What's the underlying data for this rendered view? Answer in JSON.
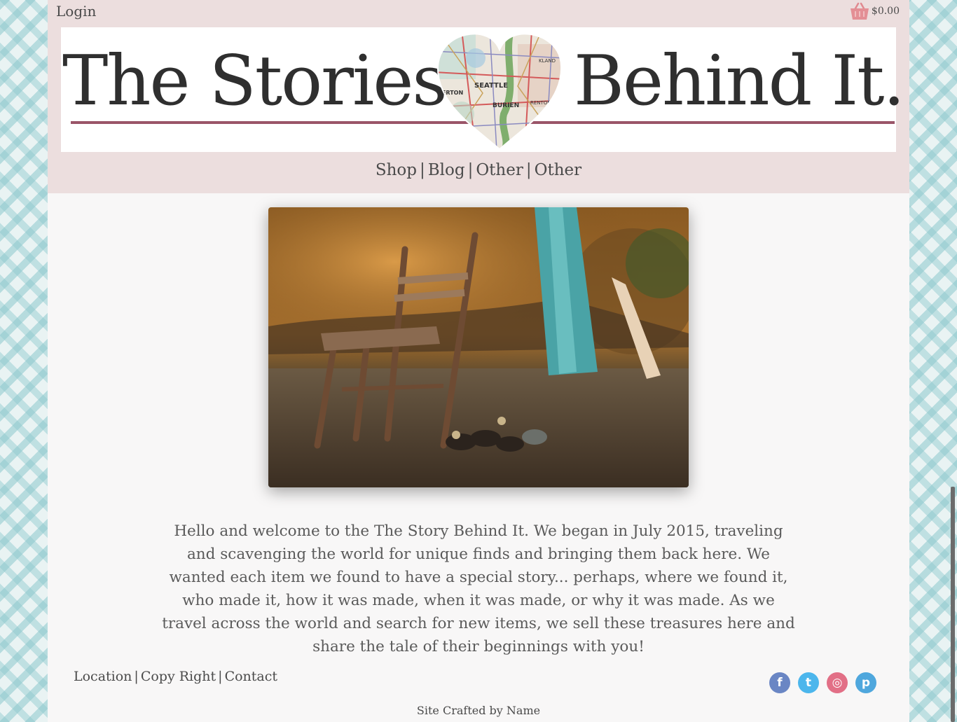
{
  "header": {
    "login_label": "Login",
    "cart_total": "$0.00",
    "cart_icon": "shopping-basket-icon"
  },
  "banner": {
    "title_left": "The Stories",
    "title_right": "Behind It.",
    "map_labels": [
      "SEATTLE",
      "BURIEN",
      "MERTON",
      "KLAND",
      "RENTON"
    ],
    "underline_color": "#9a5568"
  },
  "nav": {
    "items": [
      "Shop",
      "Blog",
      "Other",
      "Other"
    ],
    "separator": "|"
  },
  "intro": {
    "text": "Hello and welcome to the The Story Behind It. We began in July 2015, traveling and scavenging the world for unique finds and bringing them back here. We wanted each item we found to have a special story... perhaps, where we found it, who made it, how it was made, when it was made, or why it was made. As we travel across the world and search for new items, we sell these treasures here and share the tale of their beginnings with you!"
  },
  "footer": {
    "links": [
      "Location",
      "Copy Right",
      "Contact"
    ],
    "separator": "|",
    "credit": "Site Crafted by Name",
    "social": [
      {
        "icon": "facebook-icon",
        "glyph": "f",
        "color": "#6a86c4"
      },
      {
        "icon": "twitter-icon",
        "glyph": "t",
        "color": "#4cb6ec"
      },
      {
        "icon": "instagram-icon",
        "glyph": "◎",
        "color": "#e26f86"
      },
      {
        "icon": "pinterest-icon",
        "glyph": "p",
        "color": "#4fa7dd"
      }
    ]
  },
  "colors": {
    "header_bg": "#ecdede",
    "page_bg": "#f8f7f7",
    "pattern": "#8cc8cd",
    "text": "#4a4a4a"
  }
}
